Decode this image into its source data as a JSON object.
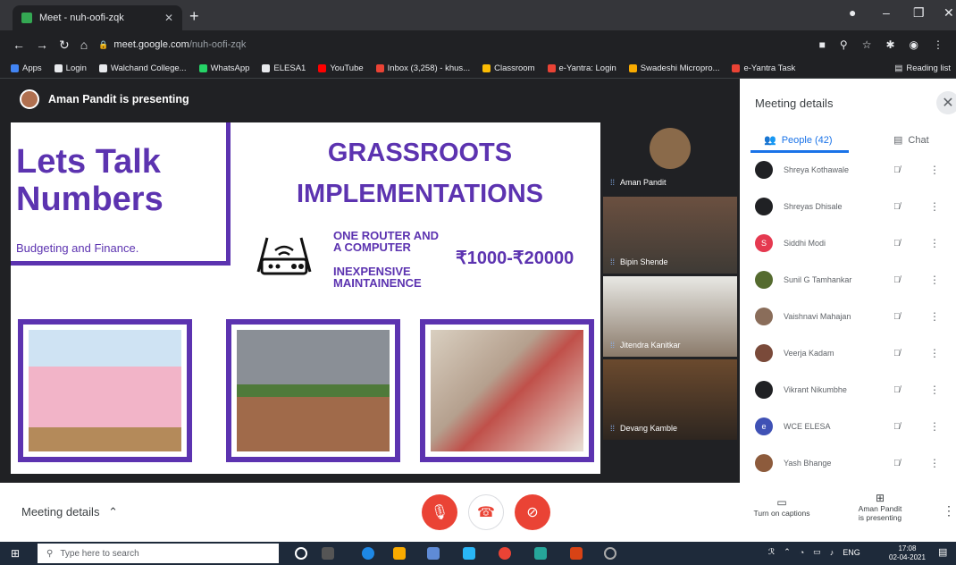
{
  "browser": {
    "tab_title": "Meet - nuh-oofi-zqk",
    "new_tab": "+",
    "url_host": "meet.google.com",
    "url_path": "/nuh-oofi-zqk",
    "bookmarks": [
      {
        "label": "Apps",
        "color": "#4285f4"
      },
      {
        "label": "Login",
        "color": "#e8eaed"
      },
      {
        "label": "Walchand College...",
        "color": "#e8eaed"
      },
      {
        "label": "WhatsApp",
        "color": "#25d366"
      },
      {
        "label": "ELESA1",
        "color": "#e8eaed"
      },
      {
        "label": "YouTube",
        "color": "#ff0000"
      },
      {
        "label": "Inbox (3,258) - khus...",
        "color": "#ea4335"
      },
      {
        "label": "Classroom",
        "color": "#fbbc04"
      },
      {
        "label": "e-Yantra: Login",
        "color": "#ea4335"
      },
      {
        "label": "Swadeshi Micropro...",
        "color": "#f9ab00"
      },
      {
        "label": "e-Yantra Task",
        "color": "#ea4335"
      }
    ],
    "reading_list": "Reading list"
  },
  "meet": {
    "presenting_banner": "Aman Pandit is presenting",
    "slide": {
      "left_title": "Lets Talk Numbers",
      "left_subtitle": "Budgeting and Finance.",
      "main_title": "GRASSROOTS IMPLEMENTATIONS",
      "line1": "ONE ROUTER AND",
      "line2": "A COMPUTER",
      "line3": "INEXPENSIVE",
      "line4": "MAINTAINENCE",
      "price": "₹1000-₹20000"
    },
    "tiles": [
      {
        "name": "Aman Pandit"
      },
      {
        "name": "Bipin Shende"
      },
      {
        "name": "Jitendra Kanitkar"
      },
      {
        "name": "Devang Kamble"
      }
    ]
  },
  "panel": {
    "title": "Meeting details",
    "tab_people": "People (42)",
    "tab_chat": "Chat",
    "people": [
      {
        "name": "Shreya Kothawale",
        "color": "#202124",
        "initial": ""
      },
      {
        "name": "Shreyas Dhisale",
        "color": "#202124",
        "initial": ""
      },
      {
        "name": "Siddhi Modi",
        "color": "#e53950",
        "initial": "S"
      },
      {
        "name": "Sunil G Tamhankar",
        "color": "#556b2f",
        "initial": ""
      },
      {
        "name": "Vaishnavi Mahajan",
        "color": "#8a6d5a",
        "initial": ""
      },
      {
        "name": "Veerja Kadam",
        "color": "#7a4a3a",
        "initial": ""
      },
      {
        "name": "Vikrant Nikumbhe",
        "color": "#202124",
        "initial": ""
      },
      {
        "name": "WCE ELESA",
        "color": "#3f51b5",
        "initial": "e"
      },
      {
        "name": "Yash Bhange",
        "color": "#8d5b3c",
        "initial": ""
      }
    ]
  },
  "bottom": {
    "meeting_details": "Meeting details",
    "captions": "Turn on captions",
    "presenting_line1": "Aman Pandit",
    "presenting_line2": "is presenting"
  },
  "taskbar": {
    "search_placeholder": "Type here to search",
    "lang": "ENG",
    "time": "17:08",
    "date": "02-04-2021"
  }
}
